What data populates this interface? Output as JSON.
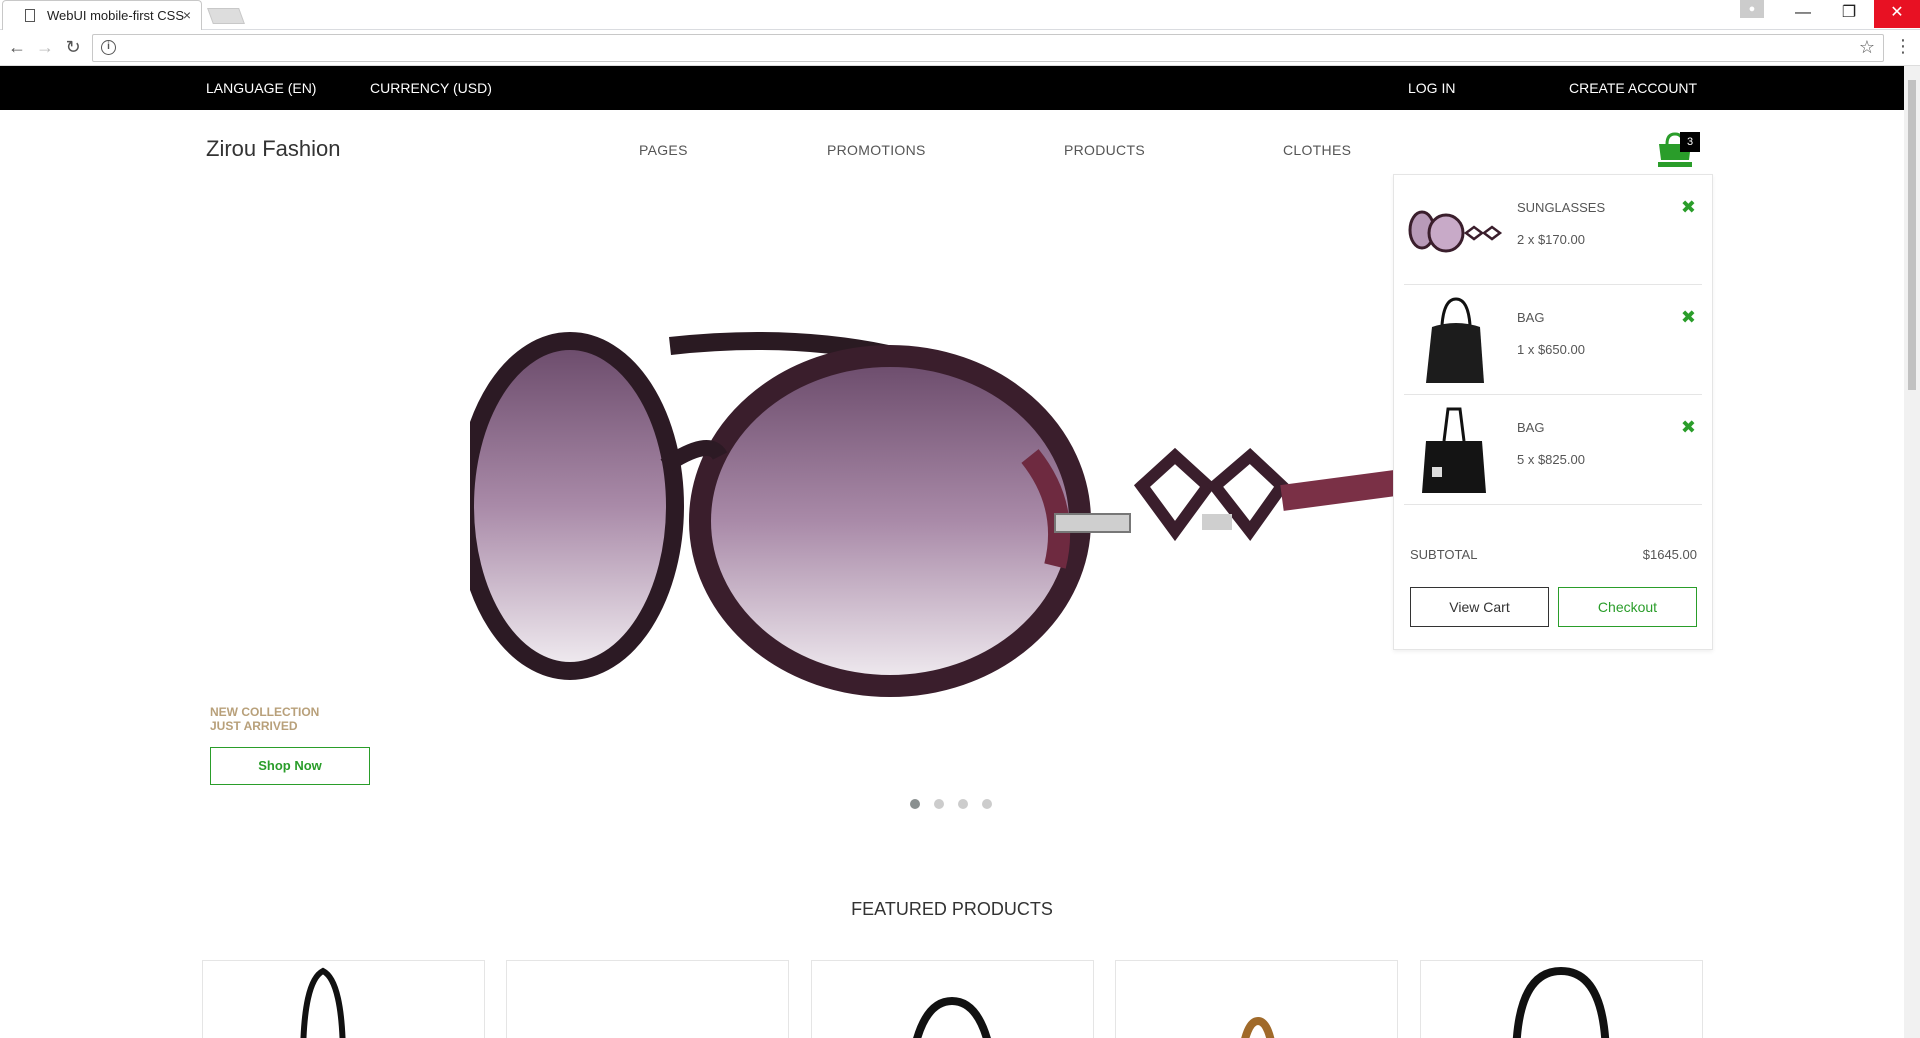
{
  "browser": {
    "tab_title": "WebUI mobile-first CSS",
    "tab_close": "×",
    "back": "←",
    "forward": "→",
    "reload": "↻",
    "info": "i",
    "star": "☆",
    "menu": "⋮",
    "minimize": "—",
    "restore": "❐",
    "close": "✕"
  },
  "topbar": {
    "language": "LANGUAGE (EN)",
    "currency": "CURRENCY (USD)",
    "login": "LOG IN",
    "create_account": "CREATE ACCOUNT"
  },
  "header": {
    "brand": "Zirou Fashion",
    "nav": [
      "PAGES",
      "PROMOTIONS",
      "PRODUCTS",
      "CLOTHES"
    ],
    "cart_count": "3"
  },
  "hero": {
    "tag_line1": "NEW COLLECTION",
    "tag_line2": "JUST ARRIVED",
    "cta": "Shop Now",
    "slides": 4,
    "active_slide": 1
  },
  "cart": {
    "items": [
      {
        "name": "SUNGLASSES",
        "qty": "2 x $170.00"
      },
      {
        "name": "BAG",
        "qty": "1 x $650.00"
      },
      {
        "name": "BAG",
        "qty": "5 x $825.00"
      }
    ],
    "remove_icon": "✖",
    "subtotal_label": "SUBTOTAL",
    "subtotal_value": "$1645.00",
    "view_cart": "View Cart",
    "checkout": "Checkout"
  },
  "featured": {
    "title": "FEATURED PRODUCTS"
  },
  "colors": {
    "accent": "#2a9d2a",
    "topbar": "#000000",
    "tag": "#b8a07a"
  }
}
